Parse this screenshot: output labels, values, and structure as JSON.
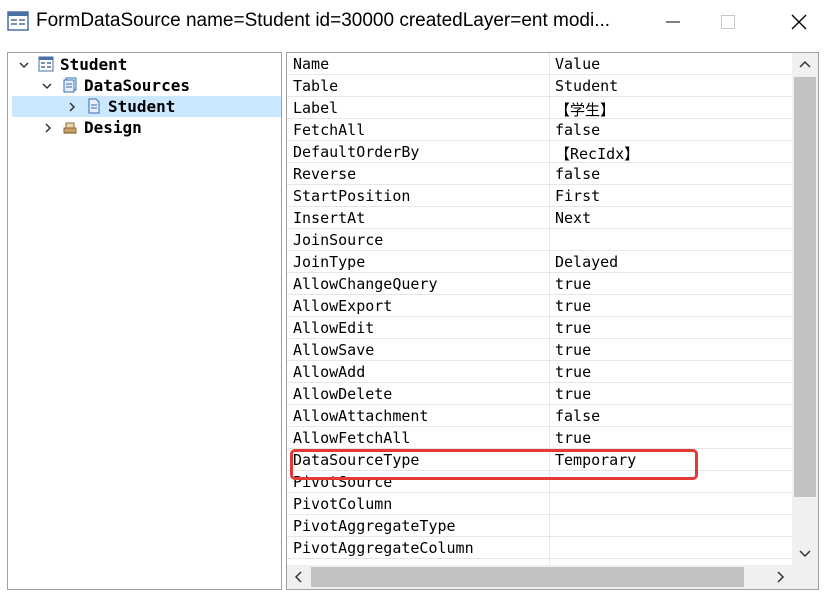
{
  "window": {
    "title": "FormDataSource name=Student id=30000 createdLayer=ent modi...",
    "icon": "form-window-icon"
  },
  "tree": {
    "items": [
      {
        "label": "Student",
        "icon": "form-icon",
        "expanded": true
      },
      {
        "label": "DataSources",
        "icon": "datasources-icon",
        "expanded": true
      },
      {
        "label": "Student",
        "icon": "datasource-icon",
        "expanded": false,
        "selected": true
      },
      {
        "label": "Design",
        "icon": "design-icon",
        "expanded": false
      }
    ]
  },
  "properties": {
    "header": {
      "name": "Name",
      "value": "Value"
    },
    "rows": [
      {
        "name": "Table",
        "value": "Student"
      },
      {
        "name": "Label",
        "value": "【学生】"
      },
      {
        "name": "FetchAll",
        "value": "false"
      },
      {
        "name": "DefaultOrderBy",
        "value": "【RecIdx】"
      },
      {
        "name": "Reverse",
        "value": "false"
      },
      {
        "name": "StartPosition",
        "value": "First"
      },
      {
        "name": "InsertAt",
        "value": "Next"
      },
      {
        "name": "JoinSource",
        "value": ""
      },
      {
        "name": "JoinType",
        "value": "Delayed"
      },
      {
        "name": "AllowChangeQuery",
        "value": "true"
      },
      {
        "name": "AllowExport",
        "value": "true"
      },
      {
        "name": "AllowEdit",
        "value": "true"
      },
      {
        "name": "AllowSave",
        "value": "true"
      },
      {
        "name": "AllowAdd",
        "value": "true"
      },
      {
        "name": "AllowDelete",
        "value": "true"
      },
      {
        "name": "AllowAttachment",
        "value": "false"
      },
      {
        "name": "AllowFetchAll",
        "value": "true"
      },
      {
        "name": "DataSourceType",
        "value": "Temporary",
        "highlighted": true
      },
      {
        "name": "PivotSource",
        "value": ""
      },
      {
        "name": "PivotColumn",
        "value": ""
      },
      {
        "name": "PivotAggregateType",
        "value": ""
      },
      {
        "name": "PivotAggregateColumn",
        "value": ""
      }
    ]
  },
  "colors": {
    "selection": "#cce8ff",
    "highlight_border": "#e53935",
    "scrollbar_thumb": "#c2c2c2",
    "scrollbar_track": "#f0f0f0"
  }
}
